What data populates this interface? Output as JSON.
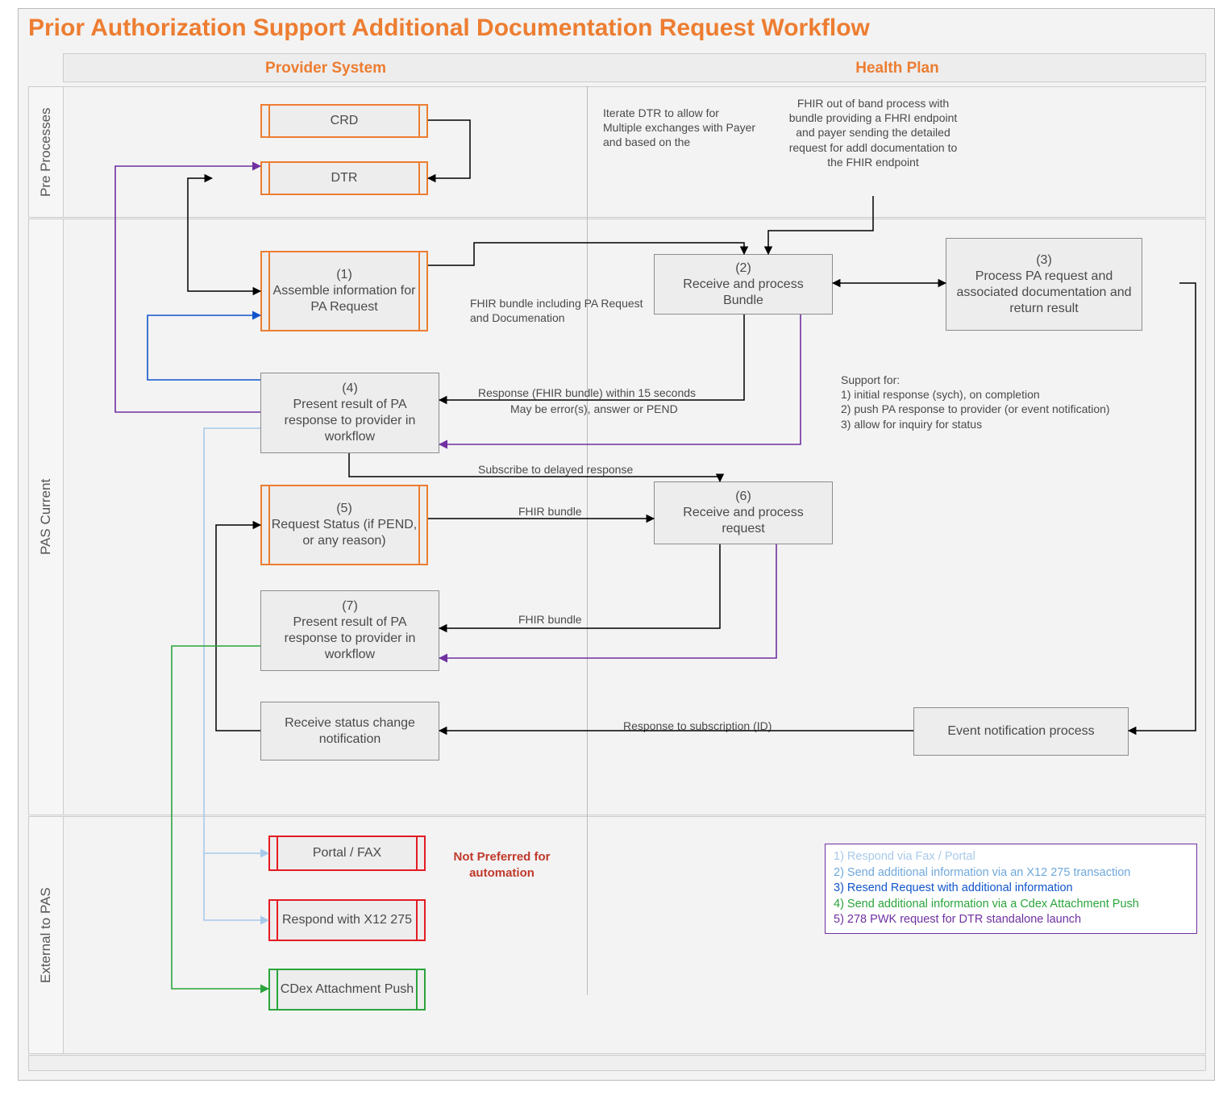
{
  "title": "Prior Authorization Support Additional Documentation Request Workflow",
  "columns": {
    "provider": "Provider System",
    "healthplan": "Health Plan"
  },
  "lanes": {
    "pre": "Pre Processes",
    "pas": "PAS Current",
    "ext": "External to PAS"
  },
  "nodes": {
    "crd": "CRD",
    "dtr": "DTR",
    "n1": {
      "num": "(1)",
      "text": "Assemble information for PA Request"
    },
    "n2": {
      "num": "(2)",
      "text": "Receive and process Bundle"
    },
    "n3": {
      "num": "(3)",
      "text": "Process PA request and associated documentation and return result"
    },
    "n4": {
      "num": "(4)",
      "text": "Present result of PA response to provider in workflow"
    },
    "n5": {
      "num": "(5)",
      "text": "Request Status (if PEND, or any reason)"
    },
    "n6": {
      "num": "(6)",
      "text": "Receive and process request"
    },
    "n7": {
      "num": "(7)",
      "text": "Present result of PA response to provider in workflow"
    },
    "n8": "Receive status change notification",
    "n9": "Event notification process",
    "portal": "Portal / FAX",
    "x12": "Respond with X12 275",
    "cdex": "CDex Attachment Push"
  },
  "labels": {
    "iterate": "Iterate DTR to allow for Multiple exchanges with Payer and based on the",
    "fhir_oob": "FHIR out of band process with bundle providing a FHRI endpoint and payer sending the detailed request for addl documentation to the FHIR endpoint",
    "fhir_bundle_req": "FHIR bundle including PA Request and Documenation",
    "response15": "Response (FHIR bundle) within 15 seconds",
    "maybe_errors": "May be error(s), answer or PEND",
    "subscribe": "Subscribe to delayed response",
    "fhir_bundle": "FHIR bundle",
    "fhir_bundle2": "FHIR bundle",
    "resp_sub": "Response to subscription (ID)",
    "support": "Support for:\n1) initial response (sych), on completion\n2) push PA response to provider (or event notification)\n3) allow for inquiry for status",
    "not_pref": "Not Preferred for automation"
  },
  "legend": {
    "1": "1) Respond via Fax / Portal",
    "2": "2) Send additional information via an X12 275 transaction",
    "3": "3) Resend Request with additional information",
    "4": "4) Send additional information via a Cdex Attachment Push",
    "5": "5) 278 PWK request for DTR standalone launch"
  }
}
